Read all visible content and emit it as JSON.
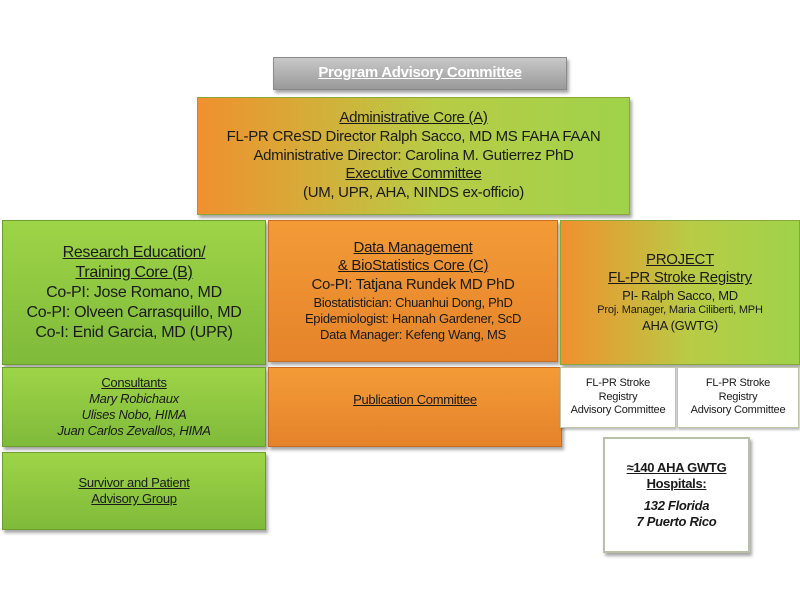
{
  "program_advisory": {
    "title": "Program Advisory Committee"
  },
  "admin_core": {
    "title": "Administrative Core (A)",
    "line1": "FL-PR CReSD Director Ralph Sacco, MD MS FAHA FAAN",
    "line2": "Administrative Director: Carolina M. Gutierrez PhD",
    "exec_title": "Executive Committee",
    "exec_members": "(UM, UPR, AHA, NINDS ex-officio)"
  },
  "research_core": {
    "title1": "Research Education/",
    "title2": "Training Core (B)",
    "lines": [
      "Co-PI: Jose Romano, MD",
      "Co-PI: Olveen Carrasquillo, MD",
      "Co-I: Enid Garcia, MD (UPR)"
    ]
  },
  "data_core": {
    "title1": "Data Management",
    "title2": "& BioStatistics Core (C)",
    "lead": "Co-PI: Tatjana Rundek MD PhD",
    "lines": [
      "Biostatistician: Chuanhui Dong, PhD",
      "Epidemiologist: Hannah Gardener, ScD",
      "Data Manager: Kefeng Wang, MS"
    ]
  },
  "project": {
    "title1": "PROJECT",
    "title2": "FL-PR Stroke Registry",
    "lines": [
      "PI- Ralph Sacco, MD",
      "Proj. Manager, Maria Ciliberti, MPH",
      "AHA (GWTG)"
    ]
  },
  "consultants": {
    "title": "Consultants",
    "members": [
      "Mary Robichaux",
      "Ulises Nobo, HIMA",
      "Juan Carlos Zevallos, HIMA"
    ]
  },
  "publication": {
    "title": "Publication Committee"
  },
  "registry_committees": [
    {
      "lines": [
        "FL-PR Stroke",
        "Registry",
        "Advisory Committee"
      ]
    },
    {
      "lines": [
        "FL-PR Stroke",
        "Registry",
        "Advisory Committee"
      ]
    }
  ],
  "survivor": {
    "title1": "Survivor and Patient",
    "title2": "Advisory Group"
  },
  "hospitals": {
    "title1": "≈140 AHA GWTG",
    "title2": "Hospitals:",
    "line1": "132 Florida",
    "line2": "7 Puerto Rico"
  },
  "colors": {
    "green": "#8cc63f",
    "orange": "#f0902e",
    "gray": "#a6a6a6"
  }
}
